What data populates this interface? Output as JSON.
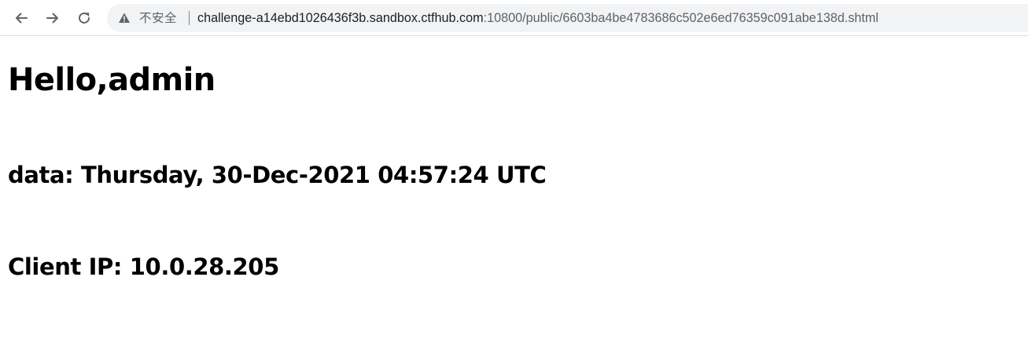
{
  "browser": {
    "security_label": "不安全",
    "url_host": "challenge-a14ebd1026436f3b.sandbox.ctfhub.com",
    "url_rest": ":10800/public/6603ba4be4783686c502e6ed76359c091abe138d.shtml",
    "icons": [
      "back-arrow-icon",
      "forward-arrow-icon",
      "reload-icon",
      "warning-triangle-icon"
    ]
  },
  "page": {
    "greeting": "Hello,admin",
    "date_line": "data: Thursday, 30-Dec-2021 04:57:24 UTC",
    "ip_line": "Client IP: 10.0.28.205"
  }
}
